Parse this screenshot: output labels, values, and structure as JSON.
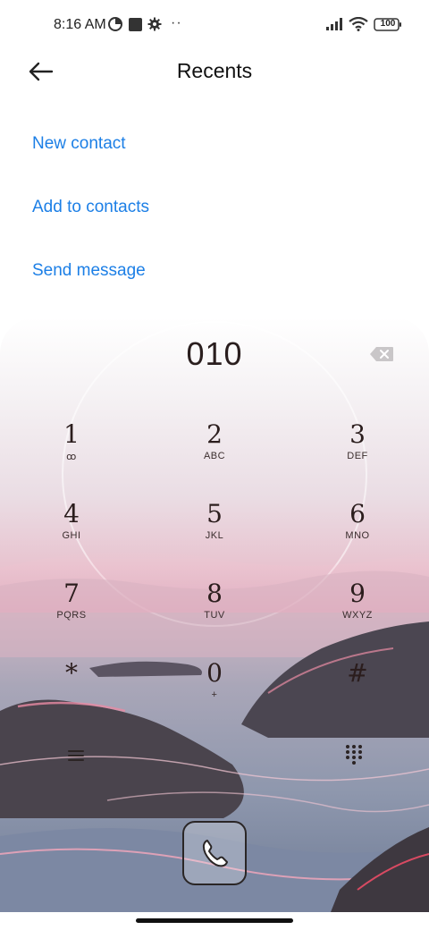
{
  "status_bar": {
    "time": "8:16 AM",
    "dots": "··",
    "battery": "100",
    "icons": [
      "data-saver-icon",
      "square-notification-icon",
      "gear-icon",
      "signal-icon",
      "wifi-icon",
      "battery-icon"
    ]
  },
  "header": {
    "title": "Recents",
    "back_icon": "arrow-left-icon"
  },
  "actions": [
    {
      "label": "New contact"
    },
    {
      "label": "Add to contacts"
    },
    {
      "label": "Send message"
    }
  ],
  "dialer": {
    "input_value": "010",
    "keys": [
      {
        "digit": "1",
        "letters": "ꝏ"
      },
      {
        "digit": "2",
        "letters": "ABC"
      },
      {
        "digit": "3",
        "letters": "DEF"
      },
      {
        "digit": "4",
        "letters": "GHI"
      },
      {
        "digit": "5",
        "letters": "JKL"
      },
      {
        "digit": "6",
        "letters": "MNO"
      },
      {
        "digit": "7",
        "letters": "PQRS"
      },
      {
        "digit": "8",
        "letters": "TUV"
      },
      {
        "digit": "9",
        "letters": "WXYZ"
      },
      {
        "digit": "*",
        "letters": ""
      },
      {
        "digit": "0",
        "letters": "+"
      },
      {
        "digit": "#",
        "letters": ""
      }
    ]
  },
  "colors": {
    "accent": "#1c7fe6",
    "key_text": "#2b1d1d"
  }
}
